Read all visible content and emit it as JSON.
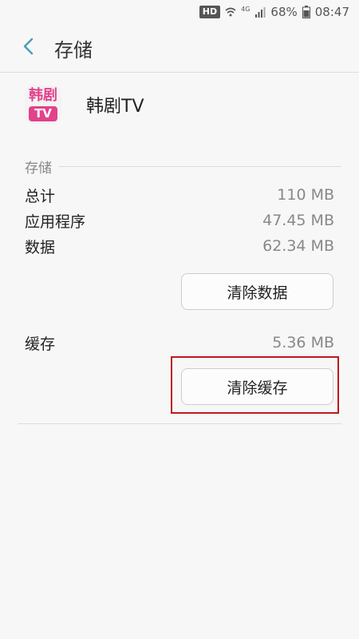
{
  "status_bar": {
    "hd": "HD",
    "network": "4G",
    "battery": "68%",
    "time": "08:47"
  },
  "header": {
    "title": "存储"
  },
  "app": {
    "icon_top": "韩剧",
    "icon_bottom": "TV",
    "name": "韩剧TV"
  },
  "storage": {
    "section_title": "存储",
    "rows": [
      {
        "label": "总计",
        "value": "110 MB"
      },
      {
        "label": "应用程序",
        "value": "47.45 MB"
      },
      {
        "label": "数据",
        "value": "62.34 MB"
      }
    ],
    "clear_data_label": "清除数据"
  },
  "cache": {
    "label": "缓存",
    "value": "5.36 MB",
    "clear_cache_label": "清除缓存"
  },
  "colors": {
    "accent": "#4a9fb5",
    "highlight": "#c0171c",
    "app_brand": "#e2418b"
  }
}
